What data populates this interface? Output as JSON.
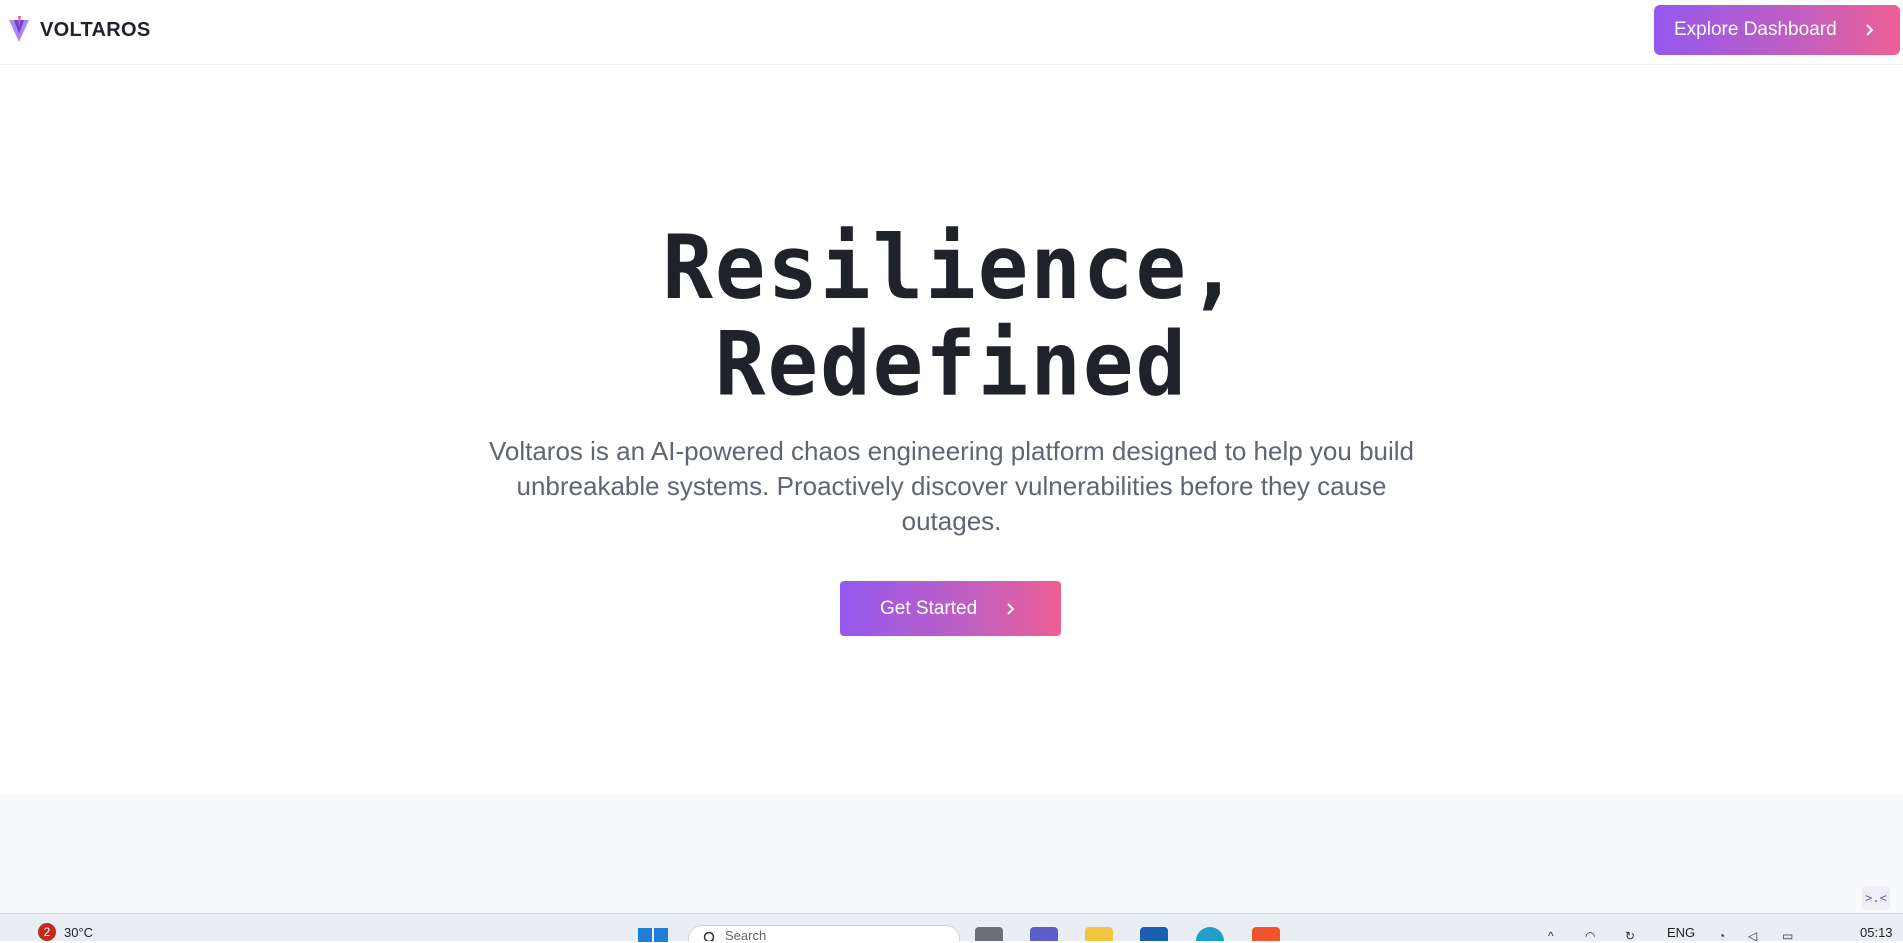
{
  "brand": {
    "name": "VOLTAROS",
    "logo_icon": "voltaros-logo-icon"
  },
  "nav": {
    "explore_label": "Explore Dashboard"
  },
  "hero": {
    "title_line1": "Resilience,",
    "title_line2": "Redefined",
    "subtitle": "Voltaros is an AI-powered chaos engineering platform designed to help you build unbreakable systems. Proactively discover vulnerabilities before they cause outages.",
    "cta_label": "Get Started"
  },
  "colors": {
    "gradient_start": "#9458ee",
    "gradient_end": "#ee5f94",
    "text_dark": "#1f2329",
    "text_muted": "#5f6571"
  },
  "widget": {
    "label": ">.<"
  },
  "taskbar": {
    "weather_badge": "2",
    "temperature": "30°C",
    "search_placeholder": "Search",
    "language": "ENG",
    "time": "05:13"
  }
}
